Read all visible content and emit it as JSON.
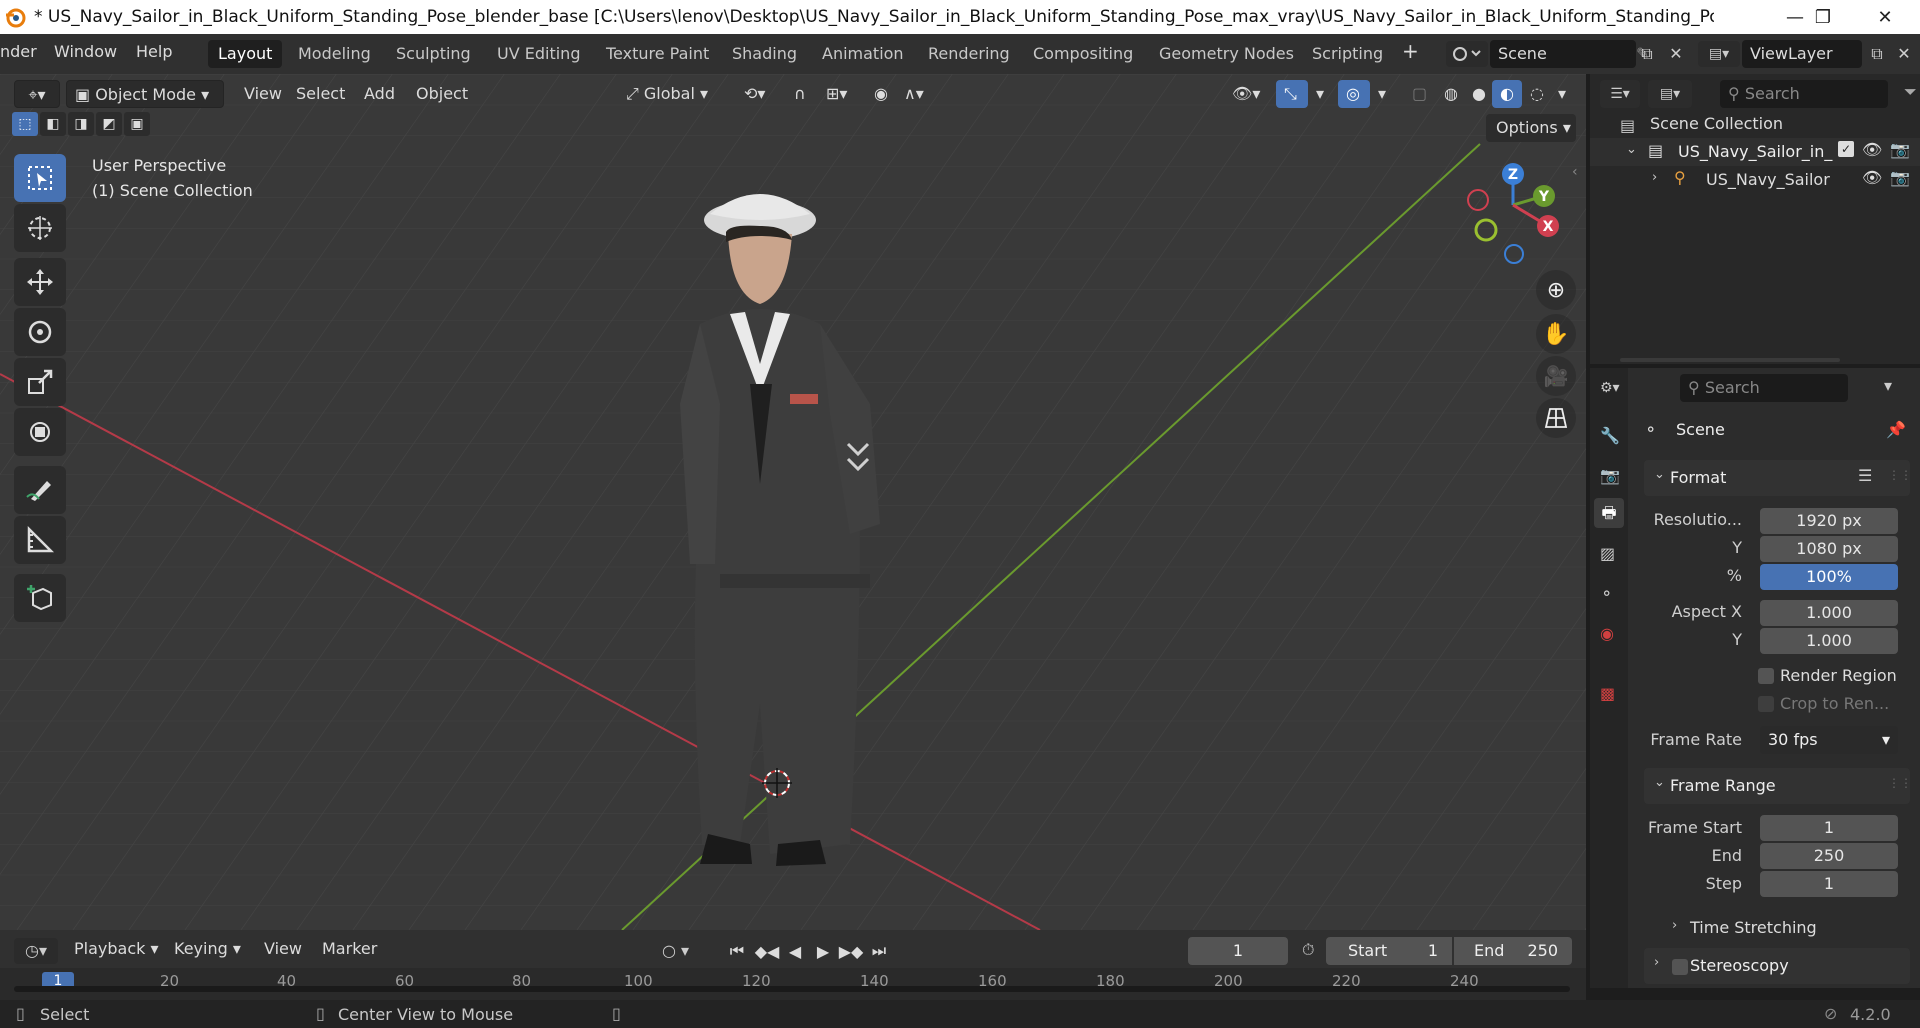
{
  "titlebar": {
    "title": "* US_Navy_Sailor_in_Black_Uniform_Standing_Pose_blender_base [C:\\Users\\lenov\\Desktop\\US_Navy_Sailor_in_Black_Uniform_Standing_Pose_max_vray\\US_Navy_Sailor_in_Black_Uniform_Standing_Pose_blender_base.blend] - B...",
    "minimize": "—",
    "restore": "❐",
    "close": "✕"
  },
  "menubar": {
    "menus": [
      "nder",
      "Window",
      "Help"
    ],
    "workspaces": [
      "Layout",
      "Modeling",
      "Sculpting",
      "UV Editing",
      "Texture Paint",
      "Shading",
      "Animation",
      "Rendering",
      "Compositing",
      "Geometry Nodes",
      "Scripting"
    ],
    "add_tab": "+",
    "scene_name": "Scene",
    "view_layer": "ViewLayer"
  },
  "viewport_header": {
    "mode": "Object Mode",
    "menus": [
      "View",
      "Select",
      "Add",
      "Object"
    ],
    "orientation": "Global",
    "options": "Options"
  },
  "viewport": {
    "overlay_line1": "User Perspective",
    "overlay_line2": "(1) Scene Collection",
    "gizmo": {
      "z": "Z",
      "y": "Y",
      "x": "X"
    }
  },
  "outliner": {
    "search_placeholder": "Search",
    "root": "Scene Collection",
    "collection": "US_Navy_Sailor_in_",
    "object": "US_Navy_Sailor"
  },
  "properties": {
    "search_placeholder": "Search",
    "context": "Scene",
    "format": {
      "title": "Format",
      "resolution_label": "Resolutio...",
      "res_x": "1920 px",
      "y_label": "Y",
      "res_y": "1080 px",
      "pct_label": "%",
      "res_pct": "100%",
      "aspect_label": "Aspect X",
      "aspect_x": "1.000",
      "aspect_y_label": "Y",
      "aspect_y": "1.000",
      "render_region": "Render Region",
      "crop": "Crop to Ren...",
      "frame_rate_label": "Frame Rate",
      "frame_rate": "30 fps"
    },
    "frame_range": {
      "title": "Frame Range",
      "start_label": "Frame Start",
      "start": "1",
      "end_label": "End",
      "end": "250",
      "step_label": "Step",
      "step": "1"
    },
    "time_stretching": "Time Stretching",
    "stereoscopy": "Stereoscopy"
  },
  "timeline": {
    "menus": [
      "Playback",
      "Keying",
      "View",
      "Marker"
    ],
    "current_frame": "1",
    "start_label": "Start",
    "start": "1",
    "end_label": "End",
    "end": "250",
    "ticks": [
      "1",
      "20",
      "40",
      "60",
      "80",
      "100",
      "120",
      "140",
      "160",
      "180",
      "200",
      "220",
      "240"
    ]
  },
  "statusbar": {
    "select": "Select",
    "center": "Center View to Mouse",
    "version": "4.2.0"
  },
  "colors": {
    "accent": "#4772b3",
    "x_axis": "#b43a48",
    "y_axis": "#6a9a2e",
    "z_axis": "#3b7fd6"
  }
}
